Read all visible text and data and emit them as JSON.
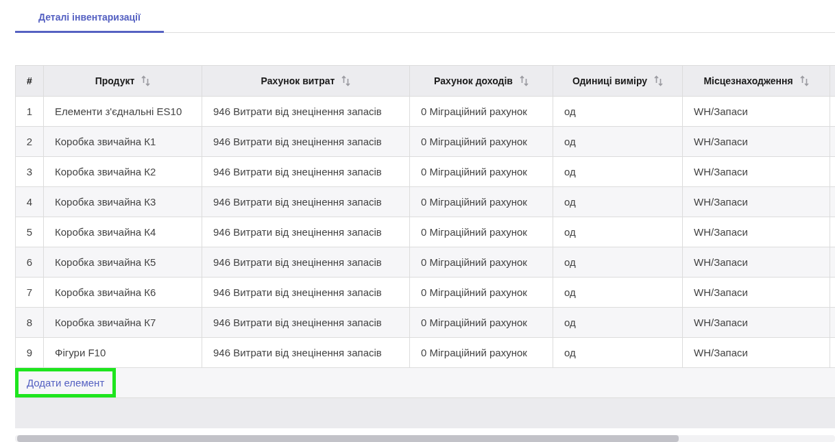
{
  "tabs": [
    {
      "label": "Деталі інвентаризації",
      "selected": true
    }
  ],
  "table": {
    "columns": [
      {
        "label": "#",
        "sortable": false
      },
      {
        "label": "Продукт",
        "sortable": true
      },
      {
        "label": "Рахунок витрат",
        "sortable": true
      },
      {
        "label": "Рахунок доходів",
        "sortable": true
      },
      {
        "label": "Одиниці виміру",
        "sortable": true
      },
      {
        "label": "Місцезнаходження",
        "sortable": true
      }
    ],
    "rows": [
      [
        "1",
        "Елементи з'єднальні ES10",
        "946 Витрати від знецінення запасів",
        "0 Міграційний рахунок",
        "од",
        "WH/Запаси"
      ],
      [
        "2",
        "Коробка звичайна К1",
        "946 Витрати від знецінення запасів",
        "0 Міграційний рахунок",
        "од",
        "WH/Запаси"
      ],
      [
        "3",
        "Коробка звичайна К2",
        "946 Витрати від знецінення запасів",
        "0 Міграційний рахунок",
        "од",
        "WH/Запаси"
      ],
      [
        "4",
        "Коробка звичайна К3",
        "946 Витрати від знецінення запасів",
        "0 Міграційний рахунок",
        "од",
        "WH/Запаси"
      ],
      [
        "5",
        "Коробка звичайна К4",
        "946 Витрати від знецінення запасів",
        "0 Міграційний рахунок",
        "од",
        "WH/Запаси"
      ],
      [
        "6",
        "Коробка звичайна К5",
        "946 Витрати від знецінення запасів",
        "0 Міграційний рахунок",
        "од",
        "WH/Запаси"
      ],
      [
        "7",
        "Коробка звичайна К6",
        "946 Витрати від знецінення запасів",
        "0 Міграційний рахунок",
        "од",
        "WH/Запаси"
      ],
      [
        "8",
        "Коробка звичайна К7",
        "946 Витрати від знецінення запасів",
        "0 Міграційний рахунок",
        "од",
        "WH/Запаси"
      ],
      [
        "9",
        "Фігури F10",
        "946 Витрати від знецінення запасів",
        "0 Міграційний рахунок",
        "од",
        "WH/Запаси"
      ]
    ],
    "add_link": {
      "label": "Додати елемент",
      "highlighted": true
    }
  }
}
